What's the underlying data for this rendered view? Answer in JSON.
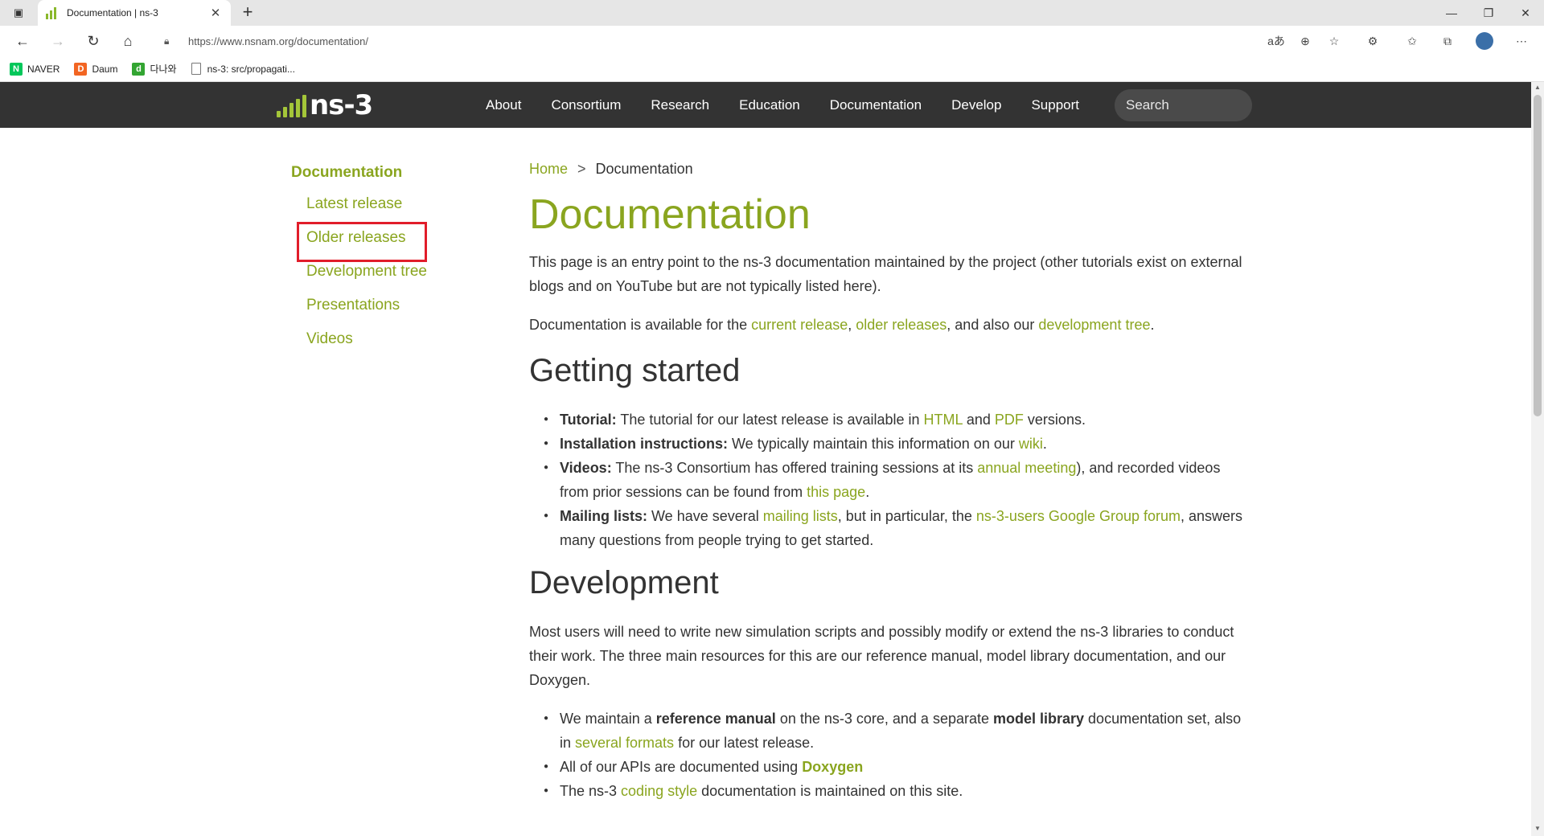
{
  "browser": {
    "tab_title": "Documentation | ns-3",
    "url": "https://www.nsnam.org/documentation/",
    "bookmarks": [
      {
        "label": "NAVER",
        "icon": "naver-icon",
        "color": "#03c75a"
      },
      {
        "label": "Daum",
        "icon": "daum-icon",
        "color": "#f26522"
      },
      {
        "label": "다나와",
        "icon": "danawa-icon",
        "color": "#33a532"
      },
      {
        "label": "ns-3: src/propagati...",
        "icon": "page-icon",
        "color": "#666666"
      }
    ]
  },
  "header": {
    "logo_text": "ns-3",
    "nav": [
      "About",
      "Consortium",
      "Research",
      "Education",
      "Documentation",
      "Develop",
      "Support"
    ],
    "search_placeholder": "Search"
  },
  "sidebar": {
    "heading": "Documentation",
    "items": [
      "Latest release",
      "Older releases",
      "Development tree",
      "Presentations",
      "Videos"
    ]
  },
  "breadcrumb": {
    "home": "Home",
    "separator": ">",
    "current": "Documentation"
  },
  "main": {
    "title": "Documentation",
    "intro": "This page is an entry point to the ns-3 documentation maintained by the project (other tutorials exist on external blogs and on YouTube but are not typically listed here).",
    "avail": {
      "prefix": "Documentation is available for the ",
      "link1": "current release",
      "sep1": ", ",
      "link2": "older releases",
      "sep2": ", and also our ",
      "link3": "development tree",
      "suffix": "."
    },
    "getting_started": {
      "heading": "Getting started",
      "tutorial": {
        "label": "Tutorial:",
        "text1": " The tutorial for our latest release is available in ",
        "html": "HTML",
        "and": " and ",
        "pdf": "PDF",
        "text2": " versions."
      },
      "install": {
        "label": "Installation instructions:",
        "text1": " We typically maintain this information on our ",
        "wiki": "wiki",
        "text2": "."
      },
      "videos": {
        "label": "Videos:",
        "text1": " The ns-3 Consortium has offered training sessions at its ",
        "annual": "annual meeting",
        "text2": "), and recorded videos from prior sessions can be found from ",
        "thispage": "this page",
        "text3": "."
      },
      "mailing": {
        "label": "Mailing lists:",
        "text1": " We have several ",
        "lists": "mailing lists",
        "text2": ", but in particular, the ",
        "forum": "ns-3-users Google Group forum",
        "text3": ", answers many questions from people trying to get started."
      }
    },
    "development": {
      "heading": "Development",
      "intro": "Most users will need to write new simulation scripts and possibly modify or extend the ns-3 libraries to conduct their work. The three main resources for this are our reference manual, model library documentation, and our Doxygen.",
      "item1": {
        "t1": "We maintain a ",
        "b1": "reference manual",
        "t2": " on the ns-3 core, and a separate ",
        "b2": "model library",
        "t3": " documentation set, also in ",
        "link": "several formats",
        "t4": " for our latest release."
      },
      "item2": {
        "t1": "All of our APIs are documented using ",
        "link": "Doxygen"
      },
      "item3": {
        "t1": "The ns-3 ",
        "link": "coding style",
        "t2": " documentation is maintained on this site."
      }
    }
  },
  "colors": {
    "accent": "#8aa51f",
    "header_bg": "#333333",
    "highlight_box": "#e11d2a"
  }
}
